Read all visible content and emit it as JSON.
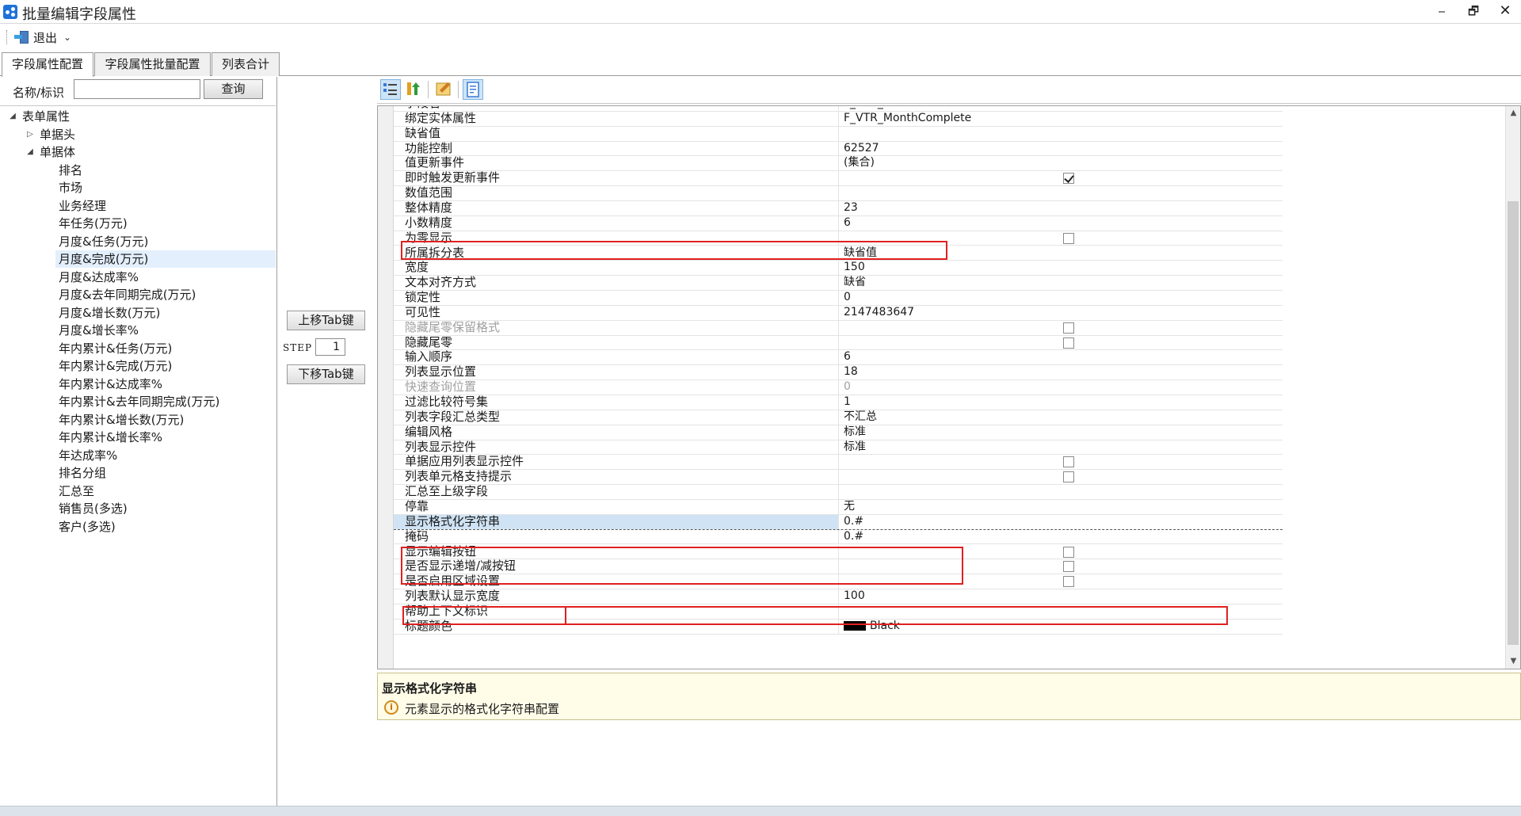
{
  "window": {
    "title": "批量编辑字段属性",
    "controls": {
      "minimize": "‒",
      "maximize": "🗗",
      "close": "✕"
    }
  },
  "toolbar": {
    "exit_label": "退出",
    "exit_icon": "exit-door-icon",
    "dropdown_icon": "chevron-down-icon"
  },
  "tabs": [
    {
      "label": "字段属性配置",
      "active": true
    },
    {
      "label": "字段属性批量配置",
      "active": false
    },
    {
      "label": "列表合计",
      "active": false
    }
  ],
  "left": {
    "search_label": "名称/标识",
    "search_value": "",
    "search_button": "查询",
    "tree": [
      {
        "label": "表单属性",
        "level": 0,
        "toggle": "◢"
      },
      {
        "label": "单据头",
        "level": 1,
        "toggle": "▷"
      },
      {
        "label": "单据体",
        "level": 1,
        "toggle": "◢"
      },
      {
        "label": "排名",
        "level": 2
      },
      {
        "label": "市场",
        "level": 2
      },
      {
        "label": "业务经理",
        "level": 2
      },
      {
        "label": "年任务(万元)",
        "level": 2
      },
      {
        "label": "月度&任务(万元)",
        "level": 2
      },
      {
        "label": "月度&完成(万元)",
        "level": 2,
        "selected": true
      },
      {
        "label": "月度&达成率%",
        "level": 2
      },
      {
        "label": "月度&去年同期完成(万元)",
        "level": 2
      },
      {
        "label": "月度&增长数(万元)",
        "level": 2
      },
      {
        "label": "月度&增长率%",
        "level": 2
      },
      {
        "label": "年内累计&任务(万元)",
        "level": 2
      },
      {
        "label": "年内累计&完成(万元)",
        "level": 2
      },
      {
        "label": "年内累计&达成率%",
        "level": 2
      },
      {
        "label": "年内累计&去年同期完成(万元)",
        "level": 2
      },
      {
        "label": "年内累计&增长数(万元)",
        "level": 2
      },
      {
        "label": "年内累计&增长率%",
        "level": 2
      },
      {
        "label": "年达成率%",
        "level": 2
      },
      {
        "label": "排名分组",
        "level": 2
      },
      {
        "label": "汇总至",
        "level": 2
      },
      {
        "label": "销售员(多选)",
        "level": 2
      },
      {
        "label": "客户(多选)",
        "level": 2
      }
    ]
  },
  "middle": {
    "move_up": "上移Tab键",
    "step_label": "STEP",
    "step_value": "1",
    "move_down": "下移Tab键"
  },
  "properties": [
    {
      "name": "字段名",
      "value": "F_VTR_MONTHCOMPLETE"
    },
    {
      "name": "绑定实体属性",
      "value": "F_VTR_MonthComplete"
    },
    {
      "name": "缺省值",
      "value": ""
    },
    {
      "name": "功能控制",
      "value": "62527"
    },
    {
      "name": "值更新事件",
      "value": "(集合)"
    },
    {
      "name": "即时触发更新事件",
      "checkbox": true,
      "checked": true
    },
    {
      "name": "数值范围",
      "value": ""
    },
    {
      "name": "整体精度",
      "value": "23"
    },
    {
      "name": "小数精度",
      "value": "6"
    },
    {
      "name": "为零显示",
      "checkbox": true,
      "checked": false
    },
    {
      "name": "所属拆分表",
      "value": "缺省值"
    },
    {
      "name": "宽度",
      "value": "150"
    },
    {
      "name": "文本对齐方式",
      "value": "缺省"
    },
    {
      "name": "锁定性",
      "value": "0"
    },
    {
      "name": "可见性",
      "value": "2147483647"
    },
    {
      "name": "隐藏尾零保留格式",
      "checkbox": true,
      "checked": false,
      "dim": true
    },
    {
      "name": "隐藏尾零",
      "checkbox": true,
      "checked": false
    },
    {
      "name": "输入顺序",
      "value": "6"
    },
    {
      "name": "列表显示位置",
      "value": "18"
    },
    {
      "name": "快速查询位置",
      "value": "0",
      "dim": true
    },
    {
      "name": "过滤比较符号集",
      "value": "1"
    },
    {
      "name": "列表字段汇总类型",
      "value": "不汇总"
    },
    {
      "name": "编辑风格",
      "value": "标准"
    },
    {
      "name": "列表显示控件",
      "value": "标准"
    },
    {
      "name": "单据应用列表显示控件",
      "checkbox": true,
      "checked": false
    },
    {
      "name": "列表单元格支持提示",
      "checkbox": true,
      "checked": false
    },
    {
      "name": "汇总至上级字段",
      "value": ""
    },
    {
      "name": "停靠",
      "value": "无"
    },
    {
      "name": "显示格式化字符串",
      "value": "0.#",
      "selected": true
    },
    {
      "name": "掩码",
      "value": "0.#"
    },
    {
      "name": "显示编辑按钮",
      "checkbox": true,
      "checked": false
    },
    {
      "name": "是否显示递增/减按钮",
      "checkbox": true,
      "checked": false
    },
    {
      "name": "是否启用区域设置",
      "checkbox": true,
      "checked": false
    },
    {
      "name": "列表默认显示宽度",
      "value": "100"
    },
    {
      "name": "帮助上下文标识",
      "value": ""
    },
    {
      "name": "标题颜色",
      "value": "Black",
      "color": "#000000"
    }
  ],
  "description": {
    "title": "显示格式化字符串",
    "text": "元素显示的格式化字符串配置",
    "icon": "info-warning-icon"
  },
  "colors": {
    "highlight": "#e02020",
    "selected_row": "#cfe3f5",
    "description_bg": "#fffde8"
  }
}
